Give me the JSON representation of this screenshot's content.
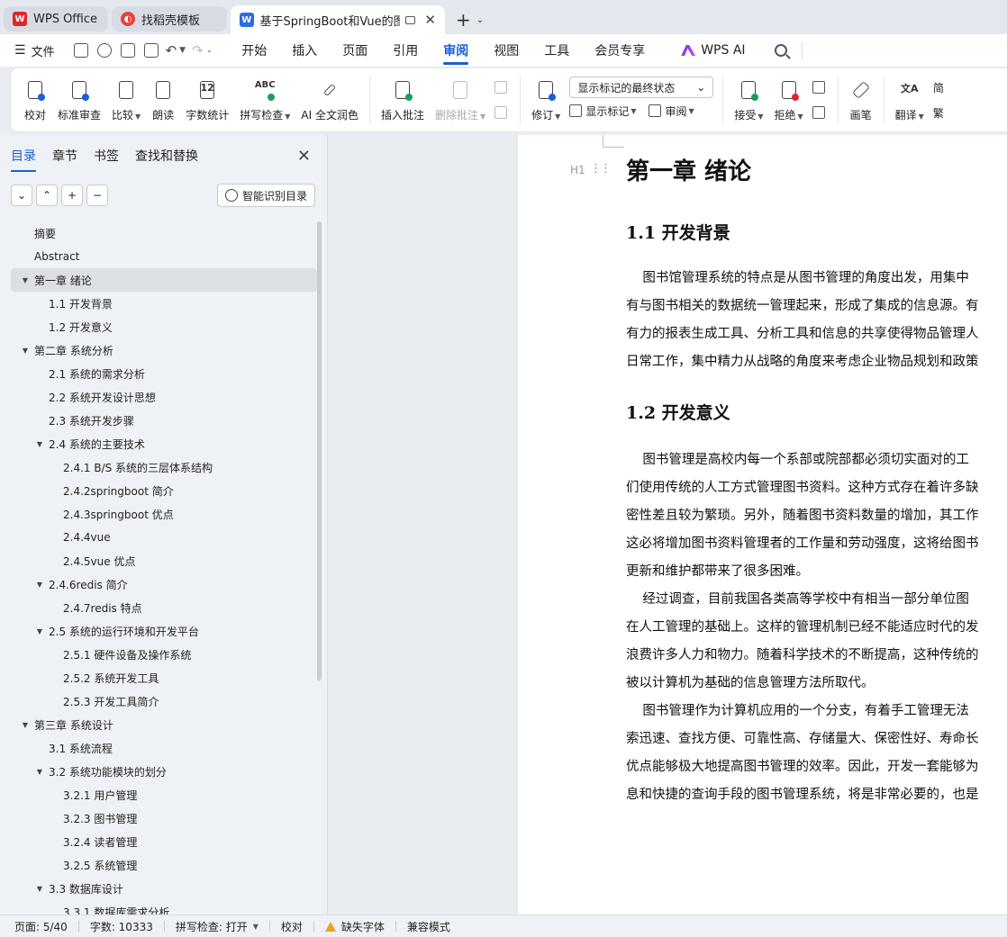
{
  "tabs": [
    {
      "label": "WPS Office",
      "icon": "wps-logo-icon",
      "state": "inactive"
    },
    {
      "label": "找稻壳模板",
      "icon": "daoke-logo-icon",
      "state": "inactive"
    },
    {
      "label": "基于SpringBoot和Vue的图书",
      "icon": "writer-logo-icon",
      "state": "active"
    }
  ],
  "menubar": {
    "file_label": "文件",
    "items": [
      "开始",
      "插入",
      "页面",
      "引用",
      "审阅",
      "视图",
      "工具",
      "会员专享"
    ],
    "active_item": "审阅",
    "ai_label": "WPS AI"
  },
  "ribbon": {
    "proofread": "校对",
    "standard_review": "标准审查",
    "compare": "比较",
    "read_aloud": "朗读",
    "word_count": "字数统计",
    "spell_check": "拼写检查",
    "ai_polish": "AI 全文润色",
    "insert_comment": "插入批注",
    "delete_comment": "删除批注",
    "track_changes": "修订",
    "markup_select": "显示标记的最终状态",
    "show_markup": "显示标记",
    "review_pane": "审阅",
    "accept": "接受",
    "reject": "拒绝",
    "pen": "画笔",
    "translate": "翻译",
    "trad_simp_1": "简",
    "trad_simp_2": "繁"
  },
  "panel": {
    "tabs": [
      "目录",
      "章节",
      "书签",
      "查找和替换"
    ],
    "active_tab": "目录",
    "smart_toc": "智能识别目录",
    "toc": [
      {
        "text": "摘要",
        "level": 1,
        "caret": ""
      },
      {
        "text": "Abstract",
        "level": 1,
        "caret": ""
      },
      {
        "text": "第一章  绪论",
        "level": 1,
        "caret": "▼",
        "selected": true
      },
      {
        "text": "1.1  开发背景",
        "level": 2,
        "caret": ""
      },
      {
        "text": "1.2  开发意义",
        "level": 2,
        "caret": ""
      },
      {
        "text": "第二章  系统分析",
        "level": 1,
        "caret": "▼"
      },
      {
        "text": "2.1  系统的需求分析",
        "level": 2,
        "caret": ""
      },
      {
        "text": "2.2  系统开发设计思想",
        "level": 2,
        "caret": ""
      },
      {
        "text": "2.3 系统开发步骤",
        "level": 2,
        "caret": ""
      },
      {
        "text": "2.4  系统的主要技术",
        "level": 2,
        "caret": "▼"
      },
      {
        "text": "2.4.1 B/S 系统的三层体系结构",
        "level": 3,
        "caret": ""
      },
      {
        "text": "2.4.2springboot 简介",
        "level": 3,
        "caret": ""
      },
      {
        "text": "2.4.3springboot 优点",
        "level": 3,
        "caret": ""
      },
      {
        "text": "2.4.4vue",
        "level": 3,
        "caret": ""
      },
      {
        "text": "2.4.5vue 优点",
        "level": 3,
        "caret": ""
      },
      {
        "text": "2.4.6redis 简介",
        "level": 2,
        "caret": "▼"
      },
      {
        "text": "2.4.7redis 特点",
        "level": 3,
        "caret": ""
      },
      {
        "text": "2.5  系统的运行环境和开发平台",
        "level": 2,
        "caret": "▼"
      },
      {
        "text": "2.5.1  硬件设备及操作系统",
        "level": 3,
        "caret": ""
      },
      {
        "text": "2.5.2  系统开发工具",
        "level": 3,
        "caret": ""
      },
      {
        "text": "2.5.3  开发工具简介",
        "level": 3,
        "caret": ""
      },
      {
        "text": "第三章  系统设计",
        "level": 1,
        "caret": "▼"
      },
      {
        "text": "3.1 系统流程",
        "level": 2,
        "caret": ""
      },
      {
        "text": "3.2  系统功能模块的划分",
        "level": 2,
        "caret": "▼"
      },
      {
        "text": "3.2.1 用户管理",
        "level": 3,
        "caret": ""
      },
      {
        "text": "3.2.3  图书管理",
        "level": 3,
        "caret": ""
      },
      {
        "text": "3.2.4 读者管理",
        "level": 3,
        "caret": ""
      },
      {
        "text": "3.2.5  系统管理",
        "level": 3,
        "caret": ""
      },
      {
        "text": "3.3 数据库设计",
        "level": 2,
        "caret": "▼"
      },
      {
        "text": "3.3.1 数据库需求分析",
        "level": 3,
        "caret": ""
      }
    ]
  },
  "document": {
    "h_marker": "H1",
    "chapter_title": "第一章  绪论",
    "section1_title": "1.1  开发背景",
    "section1_lines": [
      "    图书馆管理系统的特点是从图书管理的角度出发，用集中",
      "有与图书相关的数据统一管理起来，形成了集成的信息源。有",
      "有力的报表生成工具、分析工具和信息的共享使得物品管理人",
      "日常工作，集中精力从战略的角度来考虑企业物品规划和政策"
    ],
    "section2_title": "1.2  开发意义",
    "section2_lines": [
      "    图书管理是高校内每一个系部或院部都必须切实面对的工",
      "们使用传统的人工方式管理图书资料。这种方式存在着许多缺",
      "密性差且较为繁琐。另外，随着图书资料数量的增加，其工作",
      "这必将增加图书资料管理者的工作量和劳动强度，这将给图书",
      "更新和维护都带来了很多困难。",
      "    经过调查，目前我国各类高等学校中有相当一部分单位图",
      "在人工管理的基础上。这样的管理机制已经不能适应时代的发",
      "浪费许多人力和物力。随着科学技术的不断提高，这种传统的",
      "被以计算机为基础的信息管理方法所取代。",
      "    图书管理作为计算机应用的一个分支，有着手工管理无法",
      "索迅速、查找方便、可靠性高、存储量大、保密性好、寿命长",
      "优点能够极大地提高图书管理的效率。因此，开发一套能够为",
      "息和快捷的查询手段的图书管理系统，将是非常必要的，也是"
    ]
  },
  "statusbar": {
    "page": "页面: 5/40",
    "word_count": "字数: 10333",
    "spell_check": "拼写检查: 打开",
    "proofread": "校对",
    "missing_font": "缺失字体",
    "compat_mode": "兼容模式"
  },
  "colors": {
    "accent": "#1a5fd6",
    "wps_red": "#e0262d",
    "warning": "#f0a020"
  }
}
